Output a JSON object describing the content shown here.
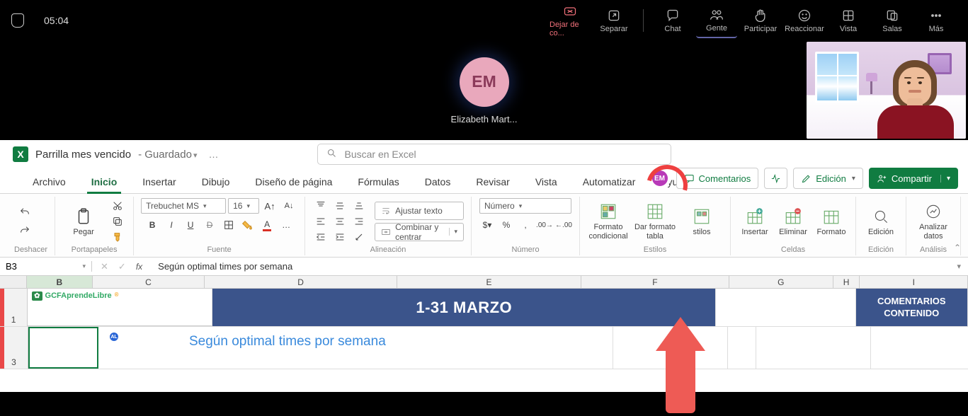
{
  "teams": {
    "timer": "05:04",
    "buttons": {
      "leave": "Dejar de co...",
      "separate": "Separar",
      "chat": "Chat",
      "people": "Gente",
      "participate": "Participar",
      "react": "Reaccionar",
      "view": "Vista",
      "rooms": "Salas",
      "more": "Más"
    },
    "speaker_initials": "EM",
    "speaker_name": "Elizabeth Mart..."
  },
  "excel": {
    "doc_title": "Parrilla mes vencido",
    "saved_label": "Guardado",
    "search_placeholder": "Buscar en Excel",
    "tabs": [
      "Archivo",
      "Inicio",
      "Insertar",
      "Dibujo",
      "Diseño de página",
      "Fórmulas",
      "Datos",
      "Revisar",
      "Vista",
      "Automatizar",
      "Ayuda"
    ],
    "active_tab": "Inicio",
    "comments_btn": "Comentarios",
    "editing_btn": "Edición",
    "share_btn": "Compartir",
    "cursor_badge": "EM",
    "ribbon": {
      "undo_group": "Deshacer",
      "clipboard": "Portapapeles",
      "paste": "Pegar",
      "font_group": "Fuente",
      "font_name": "Trebuchet MS",
      "font_size": "16",
      "align_group": "Alineación",
      "wrap": "Ajustar texto",
      "merge": "Combinar y centrar",
      "number_group": "Número",
      "number_format": "Número",
      "styles_group": "Estilos",
      "cond_fmt": "Formato condicional",
      "table_fmt": "Dar formato tabla",
      "styles_btn": "stilos",
      "cells_group": "Celdas",
      "insert_c": "Insertar",
      "delete_c": "Eliminar",
      "format_c": "Formato",
      "editing_group": "Edición",
      "editing_btn": "Edición",
      "analysis_group": "Análisis",
      "analyze": "Analizar datos"
    },
    "formula": {
      "cell_ref": "B3",
      "value": "Según optimal times por semana"
    },
    "sheet": {
      "columns": [
        "B",
        "C",
        "D",
        "E",
        "F",
        "G",
        "H",
        "I"
      ],
      "row_labels": [
        "1",
        "3"
      ],
      "logo_text": "GCFAprendeLibre",
      "banner": "1-31 MARZO",
      "banner2_l1": "COMENTARIOS",
      "banner2_l2": "CONTENIDO",
      "b3": "Según optimal times por semana",
      "presence_initials": "AL"
    }
  }
}
